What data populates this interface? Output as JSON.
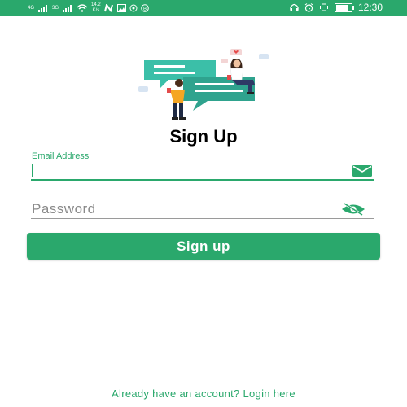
{
  "status_bar": {
    "network_1": "4G",
    "network_2": "3G",
    "speed_value": "14.2",
    "speed_unit": "K/s",
    "time": "12:30",
    "battery_level": 0.85,
    "icons": [
      "signal-icon",
      "signal-icon",
      "wifi-icon",
      "n-icon",
      "image-icon",
      "location-icon",
      "b-icon",
      "headphones-icon",
      "alarm-icon",
      "vibrate-icon",
      "battery-icon"
    ]
  },
  "page": {
    "title": "Sign Up"
  },
  "form": {
    "email_label": "Email Address",
    "email_value": "",
    "email_icon": "mail-icon",
    "password_placeholder": "Password",
    "password_icon": "eye-off-icon",
    "signup_button_label": "Sign up"
  },
  "footer": {
    "login_link": "Already have an account? Login here"
  },
  "colors": {
    "accent": "#2aa86c",
    "status_bar": "#2aa86c",
    "bubble": "#3bbfa8"
  }
}
